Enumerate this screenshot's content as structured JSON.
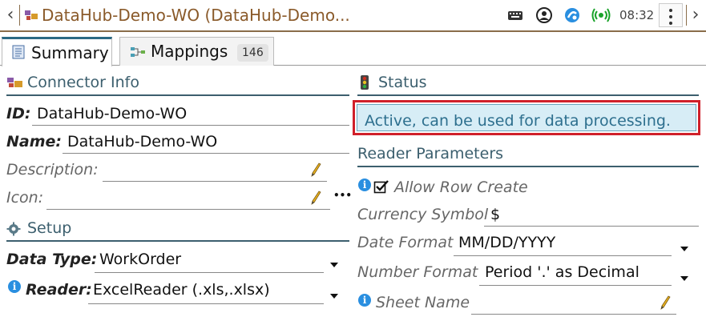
{
  "window": {
    "title": "DataHub-Demo-WO (DataHub-Demo...",
    "clock": "08:32"
  },
  "tabs": [
    {
      "label": "Summary",
      "active": true
    },
    {
      "label": "Mappings",
      "badge": "146",
      "active": false
    }
  ],
  "connector_info": {
    "section_title": "Connector Info",
    "id_label": "ID:",
    "id_value": "DataHub-Demo-WO",
    "name_label": "Name:",
    "name_value": "DataHub-Demo-WO",
    "description_label": "Description:",
    "description_value": "",
    "icon_label": "Icon:",
    "icon_value": "",
    "more_glyph": "•••"
  },
  "setup": {
    "section_title": "Setup",
    "data_type_label": "Data Type:",
    "data_type_value": "WorkOrder",
    "reader_label": "Reader:",
    "reader_value": "ExcelReader (.xls,.xlsx)"
  },
  "status": {
    "section_title": "Status",
    "message": "Active, can be used for data processing."
  },
  "reader_parameters": {
    "section_title": "Reader Parameters",
    "allow_row_create_label": "Allow Row Create",
    "allow_row_create_checked": true,
    "currency_symbol_label": "Currency Symbol",
    "currency_symbol_value": "$",
    "date_format_label": "Date Format",
    "date_format_value": "MM/DD/YYYY",
    "number_format_label": "Number Format",
    "number_format_value": "Period '.' as Decimal",
    "sheet_name_label": "Sheet Name",
    "sheet_name_value": ""
  },
  "colors": {
    "section_accent": "#3c5f6e",
    "status_border": "#d0202a",
    "status_fill": "#d7edf6",
    "title_text": "#8a5a2a"
  }
}
